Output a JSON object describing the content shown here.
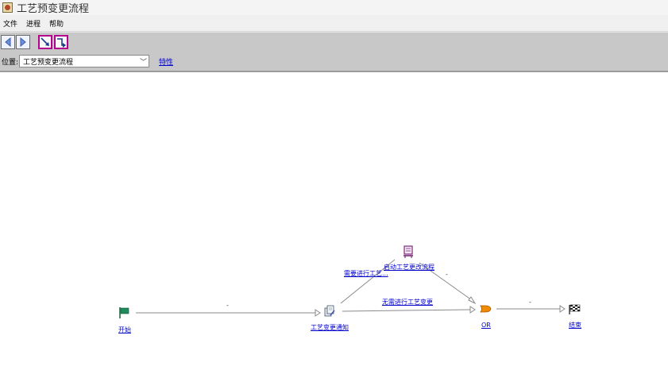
{
  "window": {
    "title": "工艺预变更流程",
    "icon": "java-cup-icon"
  },
  "menu": {
    "items": [
      "文件",
      "进程",
      "帮助"
    ]
  },
  "toolbar": {
    "buttons": [
      {
        "icon": "back-arrow-icon"
      },
      {
        "icon": "forward-arrow-icon"
      },
      {
        "icon": "diagonal-connector-icon"
      },
      {
        "icon": "elbow-connector-icon"
      }
    ]
  },
  "location": {
    "label": "位置:",
    "value": "工艺预变更流程",
    "properties_link": "特性"
  },
  "diagram": {
    "nodes": {
      "start": {
        "label": "开始",
        "icon": "green-flag-icon"
      },
      "notify": {
        "label": "工艺变更通知",
        "icon": "task-documents-icon"
      },
      "auto": {
        "label": "启动工艺更改流程",
        "icon": "automatic-process-icon"
      },
      "or": {
        "label": "OR",
        "icon": "or-gate-icon"
      },
      "end": {
        "label": "结束",
        "icon": "checkered-flag-icon"
      }
    },
    "edges": {
      "start_notify": "-",
      "notify_auto": "需要进行工艺...",
      "notify_or": "无需进行工艺变更",
      "auto_or": "-",
      "or_end": "-"
    }
  }
}
